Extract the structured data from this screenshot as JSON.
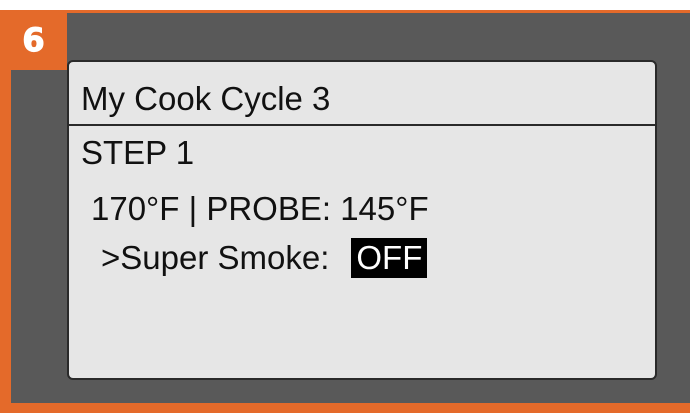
{
  "badge": {
    "number": "6"
  },
  "screen": {
    "title": "My Cook Cycle 3",
    "step": "STEP 1",
    "temperature": "170°F  |  PROBE:  145°F",
    "super_smoke": {
      "label": ">Super Smoke:",
      "value": "OFF"
    }
  },
  "colors": {
    "accent": "#e46a2a",
    "panel": "#595959",
    "screen": "#e6e6e6",
    "highlight": "#000000"
  }
}
